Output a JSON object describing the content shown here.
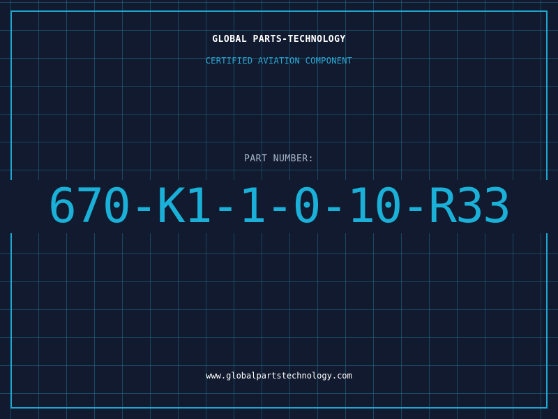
{
  "header": {
    "company": "GLOBAL PARTS-TECHNOLOGY",
    "subtitle": "CERTIFIED AVIATION COMPONENT"
  },
  "part": {
    "label": "PART NUMBER:",
    "number": "670-K1-1-0-10-R33"
  },
  "footer": {
    "website": "www.globalpartstechnology.com"
  },
  "colors": {
    "background": "#111a2e",
    "grid": "#236e8c",
    "accent": "#1ea6cf",
    "text": "#ffffff"
  }
}
